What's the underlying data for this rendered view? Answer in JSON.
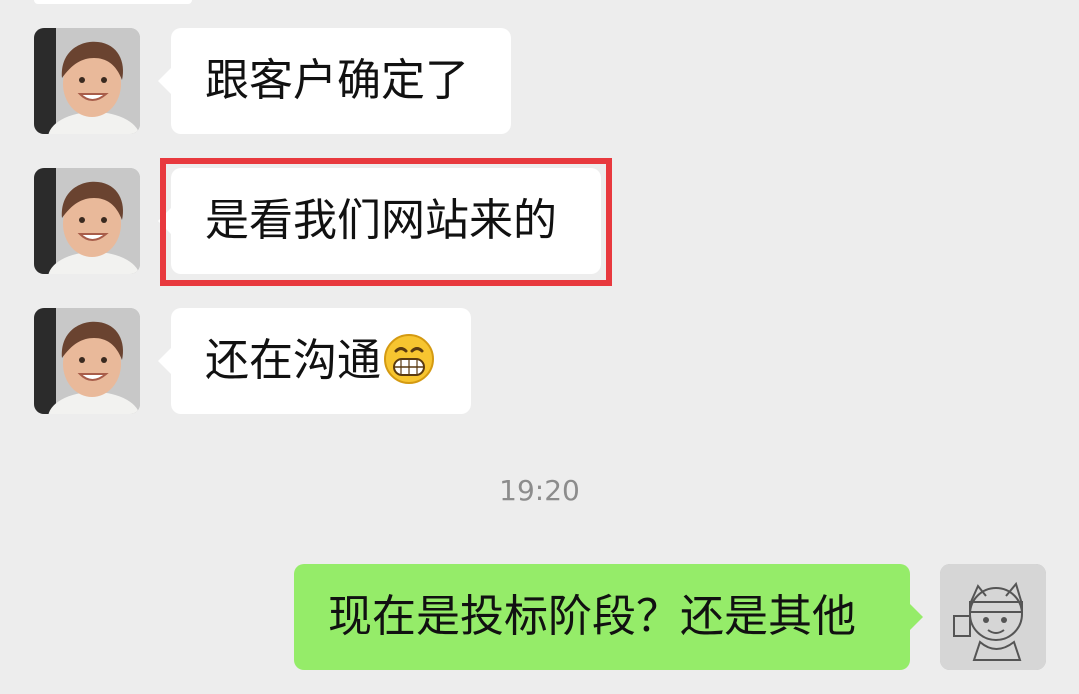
{
  "chat": {
    "messages": [
      {
        "sender": "other",
        "text": "跟客户确定了"
      },
      {
        "sender": "other",
        "text": "是看我们网站来的"
      },
      {
        "sender": "other",
        "text": "还在沟通",
        "emoji": "grinning-face-icon"
      },
      {
        "sender": "me",
        "text": "现在是投标阶段？还是其他"
      }
    ],
    "timestamp": "19:20"
  },
  "colors": {
    "background": "#ededed",
    "incoming_bubble": "#ffffff",
    "outgoing_bubble": "#95ec69",
    "highlight": "#e8393e",
    "timestamp_text": "#8c8c8c"
  }
}
